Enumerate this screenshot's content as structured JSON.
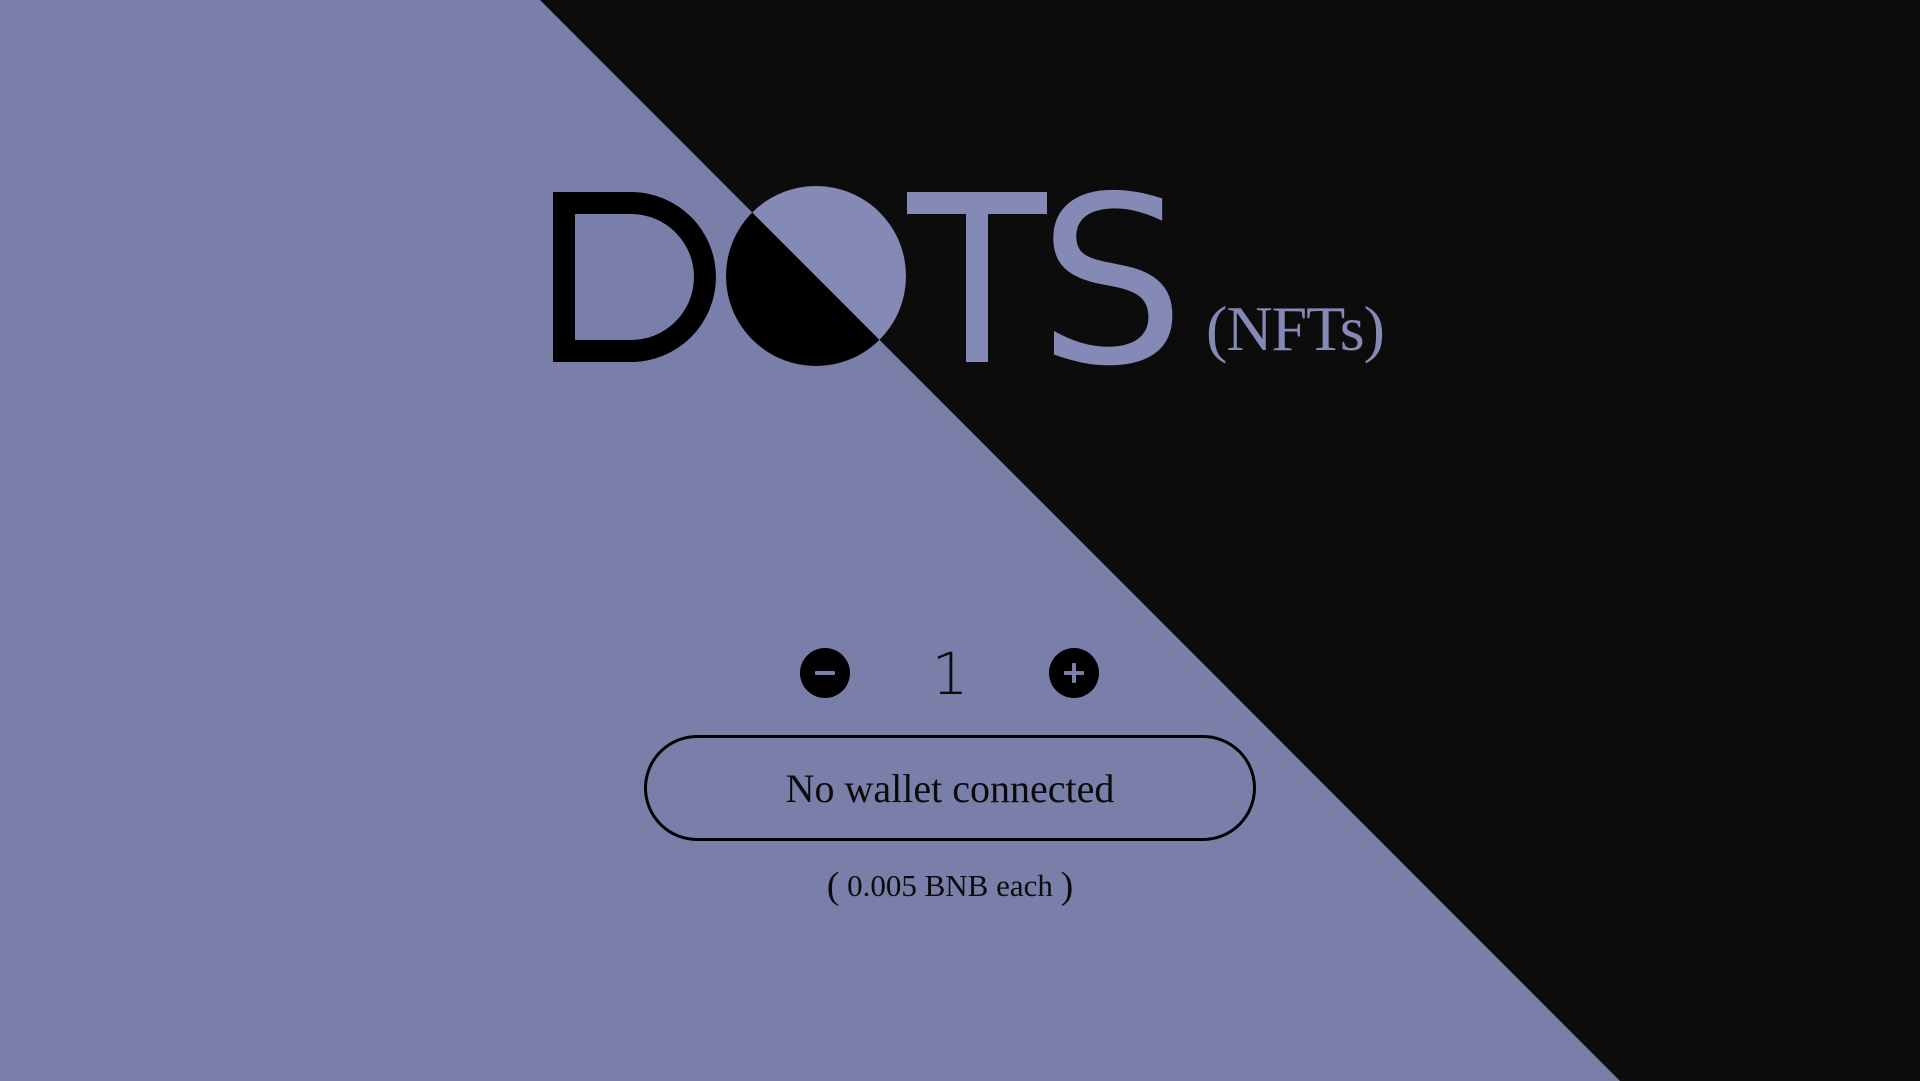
{
  "colors": {
    "lavender": "#7a7faa",
    "lavender_light": "#8589b6",
    "black": "#0c0c0c",
    "text": "#0b0b0b"
  },
  "logo": {
    "title": "DOTS",
    "letters": [
      "D",
      "O",
      "T",
      "S"
    ],
    "suffix": "(NFTs)"
  },
  "mint": {
    "decrease_icon": "minus-icon",
    "increase_icon": "plus-icon",
    "quantity": "1",
    "wallet_button_label": "No wallet connected",
    "price_open": "(",
    "price_text": "0.005 BNB each",
    "price_close": ")"
  }
}
